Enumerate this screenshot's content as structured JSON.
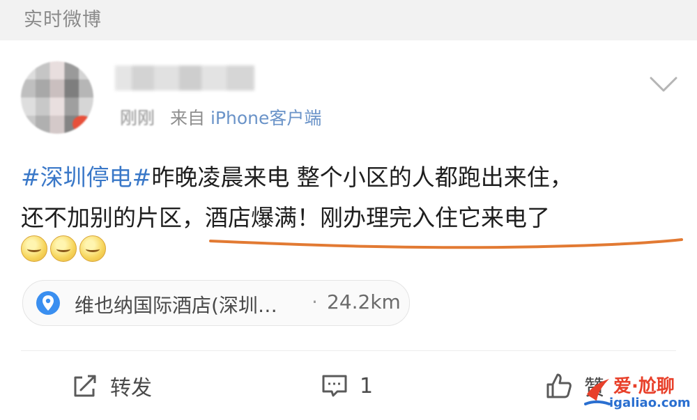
{
  "header": {
    "title": "实时微博"
  },
  "post": {
    "meta_time": "刚刚",
    "meta_source_prefix": "来自",
    "meta_source": "iPhone客户端",
    "hashtag": "#深圳停电#",
    "line1_rest": "昨晚凌晨来电 整个小区的人都跑出来住，",
    "line2": "还不加别的片区，酒店爆满！刚办理完入住它来电了"
  },
  "location": {
    "name": "维也纳国际酒店(深圳…",
    "separator": "·",
    "distance": "24.2km"
  },
  "actions": {
    "repost_label": "转发",
    "comment_count": "1",
    "like_label": "赞"
  },
  "watermark": {
    "brand": "爱·尬聊",
    "url": "igaliao.com"
  },
  "colors": {
    "link": "#3a78c8",
    "underline": "#e27a33",
    "watermark_red": "#e8402a",
    "watermark_blue": "#2a6fd0"
  }
}
